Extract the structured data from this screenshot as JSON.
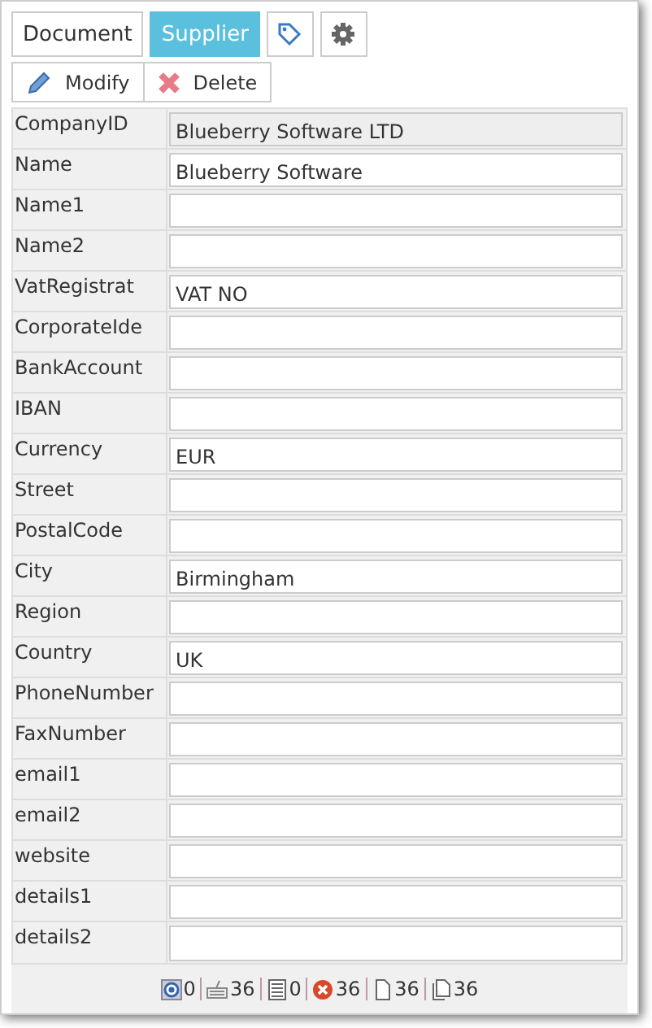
{
  "tabs": [
    {
      "label": "Document",
      "selected": false
    },
    {
      "label": "Supplier",
      "selected": true
    }
  ],
  "actions": [
    {
      "kind": "modify",
      "label": "Modify"
    },
    {
      "kind": "delete",
      "label": "Delete"
    }
  ],
  "fields": [
    {
      "label": "CompanyID",
      "value": "Blueberry Software LTD",
      "readonly": true
    },
    {
      "label": "Name",
      "value": "Blueberry Software",
      "readonly": false
    },
    {
      "label": "Name1",
      "readonly": false
    },
    {
      "label": "Name2",
      "readonly": false
    },
    {
      "label": "VatRegistrat",
      "value": "VAT NO",
      "readonly": false
    },
    {
      "label": "CorporateIde",
      "readonly": false
    },
    {
      "label": "BankAccount",
      "readonly": false
    },
    {
      "label": "IBAN",
      "readonly": false
    },
    {
      "label": "Currency",
      "value": "EUR",
      "readonly": false
    },
    {
      "label": "Street",
      "readonly": false
    },
    {
      "label": "PostalCode",
      "readonly": false
    },
    {
      "label": "City",
      "value": "Birmingham",
      "readonly": false
    },
    {
      "label": "Region",
      "readonly": false
    },
    {
      "label": "Country",
      "value": "UK",
      "readonly": false
    },
    {
      "label": "PhoneNumber",
      "readonly": false
    },
    {
      "label": "FaxNumber",
      "readonly": false
    },
    {
      "label": "email1",
      "readonly": false
    },
    {
      "label": "email2",
      "readonly": false
    },
    {
      "label": "website",
      "readonly": false
    },
    {
      "label": "details1",
      "readonly": false
    },
    {
      "label": "details2",
      "readonly": false
    }
  ],
  "status_bar": [
    {
      "kind": "target",
      "count": "0"
    },
    {
      "kind": "keyboard",
      "count": "36"
    },
    {
      "kind": "list",
      "count": "0"
    },
    {
      "kind": "error",
      "count": "36"
    },
    {
      "kind": "page",
      "count": "36"
    },
    {
      "kind": "pages",
      "count": "36"
    }
  ]
}
